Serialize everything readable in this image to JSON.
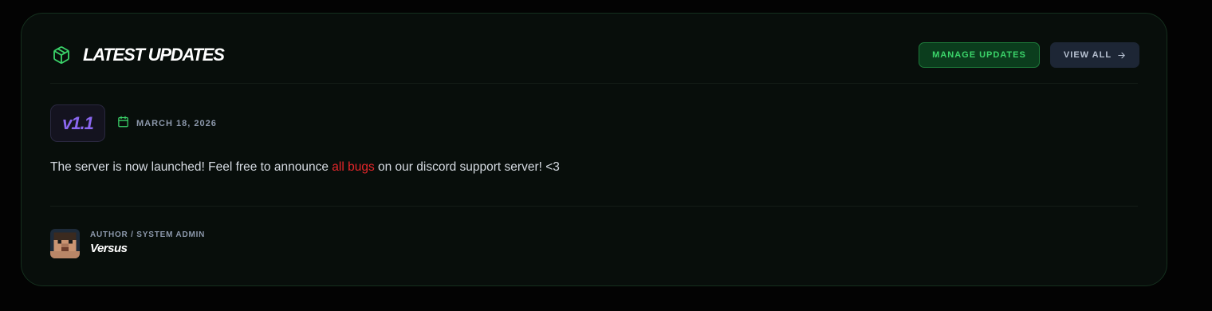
{
  "header": {
    "title": "LATEST UPDATES",
    "icon": "package-icon",
    "manage_label": "MANAGE UPDATES",
    "view_all_label": "VIEW ALL"
  },
  "update": {
    "version": "v1.1",
    "date": "MARCH 18, 2026",
    "message_before": "The server is now launched! Feel free to announce ",
    "message_highlight": "all bugs",
    "message_after": " on our discord support server! <3"
  },
  "author": {
    "role": "AUTHOR / SYSTEM ADMIN",
    "name": "Versus"
  },
  "colors": {
    "accent_green": "#3bd46a",
    "version_purple": "#8b67f0",
    "highlight_red": "#e5262a",
    "card_bg": "#080e0b"
  }
}
